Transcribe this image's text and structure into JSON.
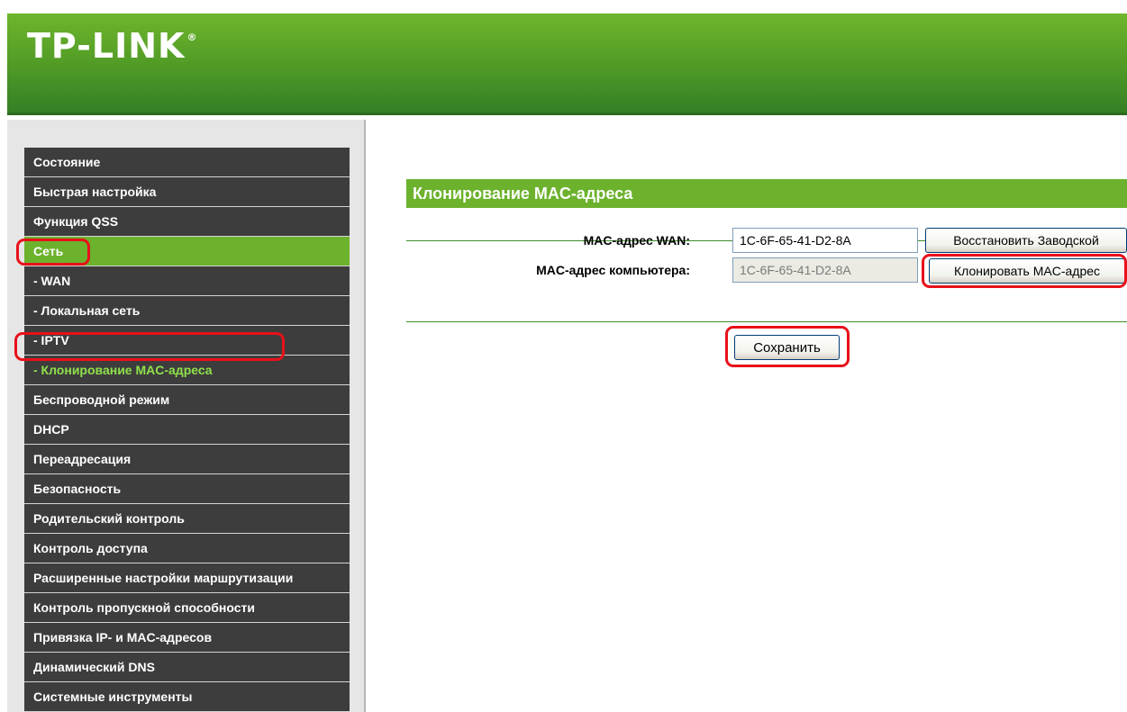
{
  "brand": {
    "logo": "TP-LINK",
    "registered_mark": "®"
  },
  "colors": {
    "accent_green": "#6cb22d",
    "menu_dark": "#3d3d3d",
    "highlight_red": "#e8101a"
  },
  "sidebar": {
    "items": [
      {
        "label": "Состояние"
      },
      {
        "label": "Быстрая настройка"
      },
      {
        "label": "Функция QSS"
      },
      {
        "label": "Сеть"
      },
      {
        "label": "- WAN"
      },
      {
        "label": "- Локальная сеть"
      },
      {
        "label": "- IPTV"
      },
      {
        "label": "- Клонирование MAC-адреса"
      },
      {
        "label": "Беспроводной режим"
      },
      {
        "label": "DHCP"
      },
      {
        "label": "Переадресация"
      },
      {
        "label": "Безопасность"
      },
      {
        "label": "Родительский контроль"
      },
      {
        "label": "Контроль доступа"
      },
      {
        "label": "Расширенные настройки маршрутизации"
      },
      {
        "label": "Контроль пропускной способности"
      },
      {
        "label": "Привязка IP- и MAC-адресов"
      },
      {
        "label": "Динамический DNS"
      },
      {
        "label": "Системные инструменты"
      }
    ]
  },
  "main": {
    "title": "Клонирование MAC-адреса",
    "wan_mac": {
      "label": "MAC-адрес WAN:",
      "value": "1C-6F-65-41-D2-8A",
      "button": "Восстановить Заводской"
    },
    "pc_mac": {
      "label": "MAC-адрес компьютера:",
      "value": "1C-6F-65-41-D2-8A",
      "button": "Клонировать MAC-адрес"
    },
    "save_button": "Сохранить"
  }
}
